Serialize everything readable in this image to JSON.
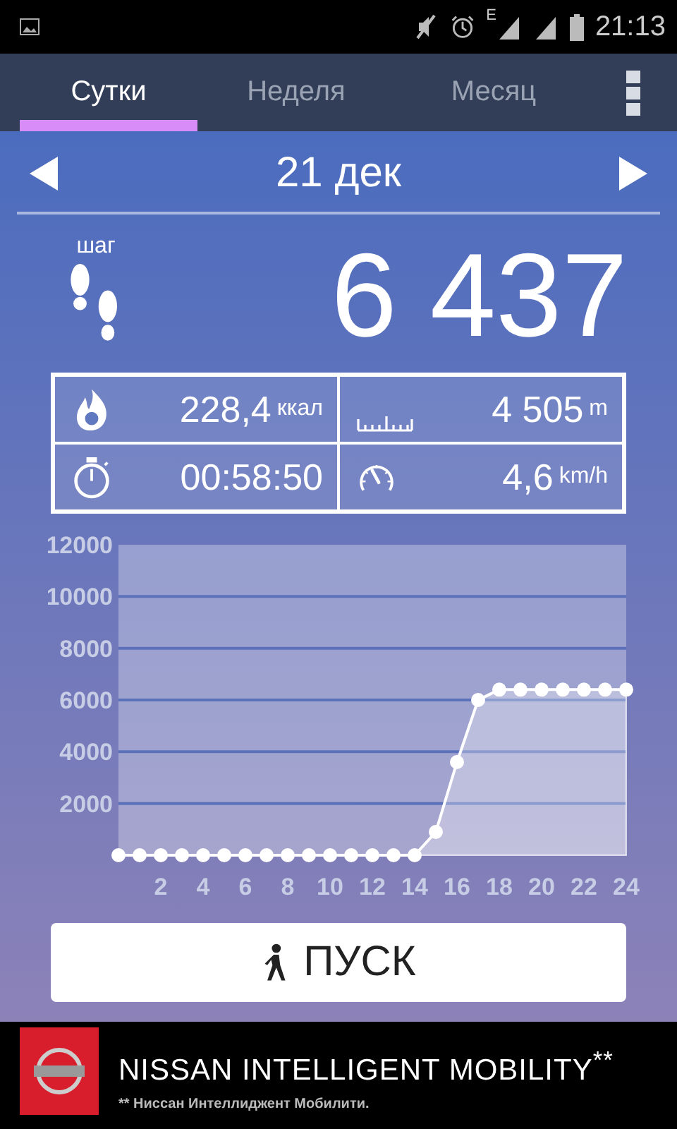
{
  "status_bar": {
    "network_label": "E",
    "time": "21:13"
  },
  "tabs": [
    {
      "label": "Сутки",
      "selected": true
    },
    {
      "label": "Неделя",
      "selected": false
    },
    {
      "label": "Месяц",
      "selected": false
    }
  ],
  "date_nav": {
    "date": "21 дек"
  },
  "steps": {
    "label": "шаг",
    "value": "6 437"
  },
  "stats": [
    {
      "kind": "calories",
      "value": "228,4",
      "unit": "ккал"
    },
    {
      "kind": "distance",
      "value": "4 505",
      "unit": "m"
    },
    {
      "kind": "duration",
      "value": "00:58:50"
    },
    {
      "kind": "speed",
      "value": "4,6",
      "unit": "km/h"
    }
  ],
  "chart": {
    "chart_data": {
      "type": "area",
      "x": [
        0,
        1,
        2,
        3,
        4,
        5,
        6,
        7,
        8,
        9,
        10,
        11,
        12,
        13,
        14,
        15,
        16,
        17,
        18,
        19,
        20,
        21,
        22,
        23,
        24
      ],
      "series": [
        {
          "color": "#ffffff",
          "values": [
            0,
            0,
            0,
            0,
            0,
            0,
            0,
            0,
            0,
            0,
            0,
            0,
            0,
            0,
            0,
            900,
            3600,
            6000,
            6400,
            6400,
            6400,
            6400,
            6400,
            6400,
            6400
          ]
        }
      ],
      "grid": true,
      "xlim": [
        0,
        24
      ],
      "ylim": [
        0,
        12000
      ],
      "xticks": [
        2,
        4,
        6,
        8,
        10,
        12,
        14,
        16,
        18,
        20,
        22,
        24
      ],
      "yticks": [
        2000,
        4000,
        6000,
        8000,
        10000,
        12000
      ]
    }
  },
  "start_button": {
    "label": "ПУСК"
  },
  "ad": {
    "headline": "NISSAN INTELLIGENT MOBILITY$^{**}$",
    "footnote": "** Ниссан Интеллиджент Мобилити."
  }
}
